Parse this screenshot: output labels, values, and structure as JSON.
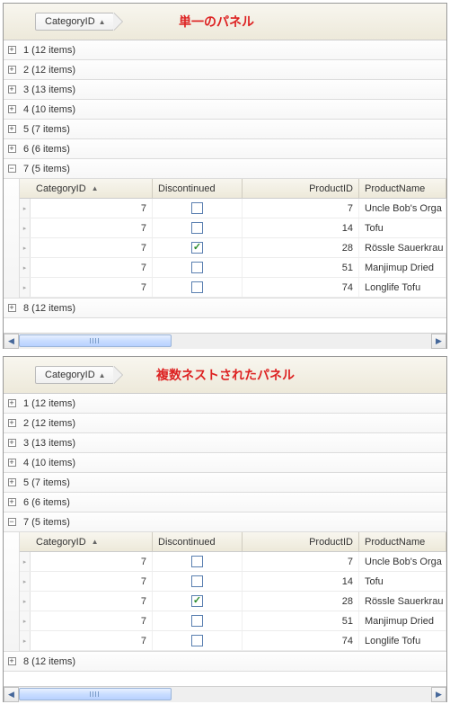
{
  "panels": [
    {
      "title": "単一のパネル",
      "groupBadge": "CategoryID"
    },
    {
      "title": "複数ネストされたパネル",
      "groupBadge": "CategoryID"
    }
  ],
  "groups": [
    {
      "label": "1 (12 items)",
      "expanded": false
    },
    {
      "label": "2 (12 items)",
      "expanded": false
    },
    {
      "label": "3 (13 items)",
      "expanded": false
    },
    {
      "label": "4 (10 items)",
      "expanded": false
    },
    {
      "label": "5 (7 items)",
      "expanded": false
    },
    {
      "label": "6 (6 items)",
      "expanded": false
    },
    {
      "label": "7 (5 items)",
      "expanded": true
    },
    {
      "label": "8 (12 items)",
      "expanded": false
    }
  ],
  "columns": {
    "categoryId": "CategoryID",
    "discontinued": "Discontinued",
    "productId": "ProductID",
    "productName": "ProductName"
  },
  "rows": [
    {
      "categoryId": "7",
      "discontinued": false,
      "productId": "7",
      "productName": "Uncle Bob's Orga"
    },
    {
      "categoryId": "7",
      "discontinued": false,
      "productId": "14",
      "productName": "Tofu"
    },
    {
      "categoryId": "7",
      "discontinued": true,
      "productId": "28",
      "productName": "Rössle Sauerkrau"
    },
    {
      "categoryId": "7",
      "discontinued": false,
      "productId": "51",
      "productName": "Manjimup Dried "
    },
    {
      "categoryId": "7",
      "discontinued": false,
      "productId": "74",
      "productName": "Longlife Tofu"
    }
  ],
  "icons": {
    "sortAsc": "▲",
    "expand": "+",
    "collapse": "−",
    "left": "◀",
    "right": "▶",
    "rowIndicator": "▸"
  }
}
